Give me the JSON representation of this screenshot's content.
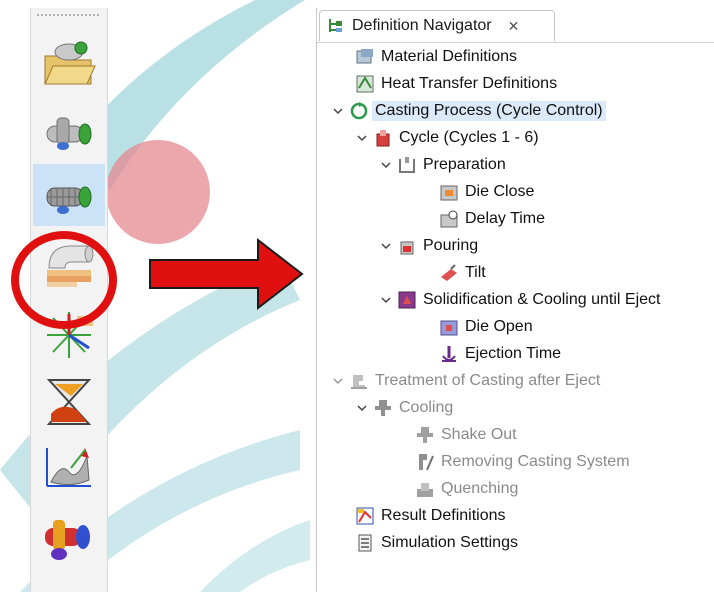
{
  "panel": {
    "title": "Definition Navigator",
    "close_glyph": "✕",
    "tab_icon": "tree-icon"
  },
  "toolbar": {
    "buttons": [
      {
        "name": "open-project-icon"
      },
      {
        "name": "geometry-icon"
      },
      {
        "name": "mesh-icon",
        "selected": true
      },
      {
        "name": "definitions-icon"
      },
      {
        "name": "optimization-icon"
      },
      {
        "name": "simulation-run-icon"
      },
      {
        "name": "results-surface-icon"
      },
      {
        "name": "results-3d-icon"
      }
    ]
  },
  "colors": {
    "highlight_ring": "#e01010",
    "arrow": "#e01010",
    "selection": "#dbe9f8",
    "disabled_text": "#8a8a8a"
  },
  "tree": {
    "items": [
      {
        "label": "Material Definitions",
        "icon": "material-icon"
      },
      {
        "label": "Heat Transfer Definitions",
        "icon": "heat-transfer-icon"
      },
      {
        "label": "Casting Process (Cycle Control)",
        "icon": "cycle-control-icon",
        "expanded": true,
        "selected": true
      },
      {
        "label": "Cycle (Cycles 1 - 6)",
        "icon": "cycle-icon",
        "expanded": true
      },
      {
        "label": "Preparation",
        "icon": "preparation-icon",
        "expanded": true
      },
      {
        "label": "Die Close",
        "icon": "die-close-icon"
      },
      {
        "label": "Delay Time",
        "icon": "delay-time-icon"
      },
      {
        "label": "Pouring",
        "icon": "pouring-icon",
        "expanded": true
      },
      {
        "label": "Tilt",
        "icon": "tilt-icon"
      },
      {
        "label": "Solidification & Cooling until Eject",
        "icon": "solidification-icon",
        "expanded": true
      },
      {
        "label": "Die Open",
        "icon": "die-open-icon"
      },
      {
        "label": "Ejection Time",
        "icon": "ejection-time-icon"
      },
      {
        "label": "Treatment of Casting after Eject",
        "icon": "treatment-icon",
        "expanded": true,
        "disabled": true
      },
      {
        "label": "Cooling",
        "icon": "cooling-icon",
        "expanded": true,
        "disabled": true
      },
      {
        "label": "Shake Out",
        "icon": "shake-out-icon",
        "disabled": true
      },
      {
        "label": "Removing Casting System",
        "icon": "removing-casting-icon",
        "disabled": true
      },
      {
        "label": "Quenching",
        "icon": "quenching-icon",
        "disabled": true
      },
      {
        "label": "Result Definitions",
        "icon": "result-definitions-icon"
      },
      {
        "label": "Simulation Settings",
        "icon": "simulation-settings-icon"
      }
    ]
  }
}
